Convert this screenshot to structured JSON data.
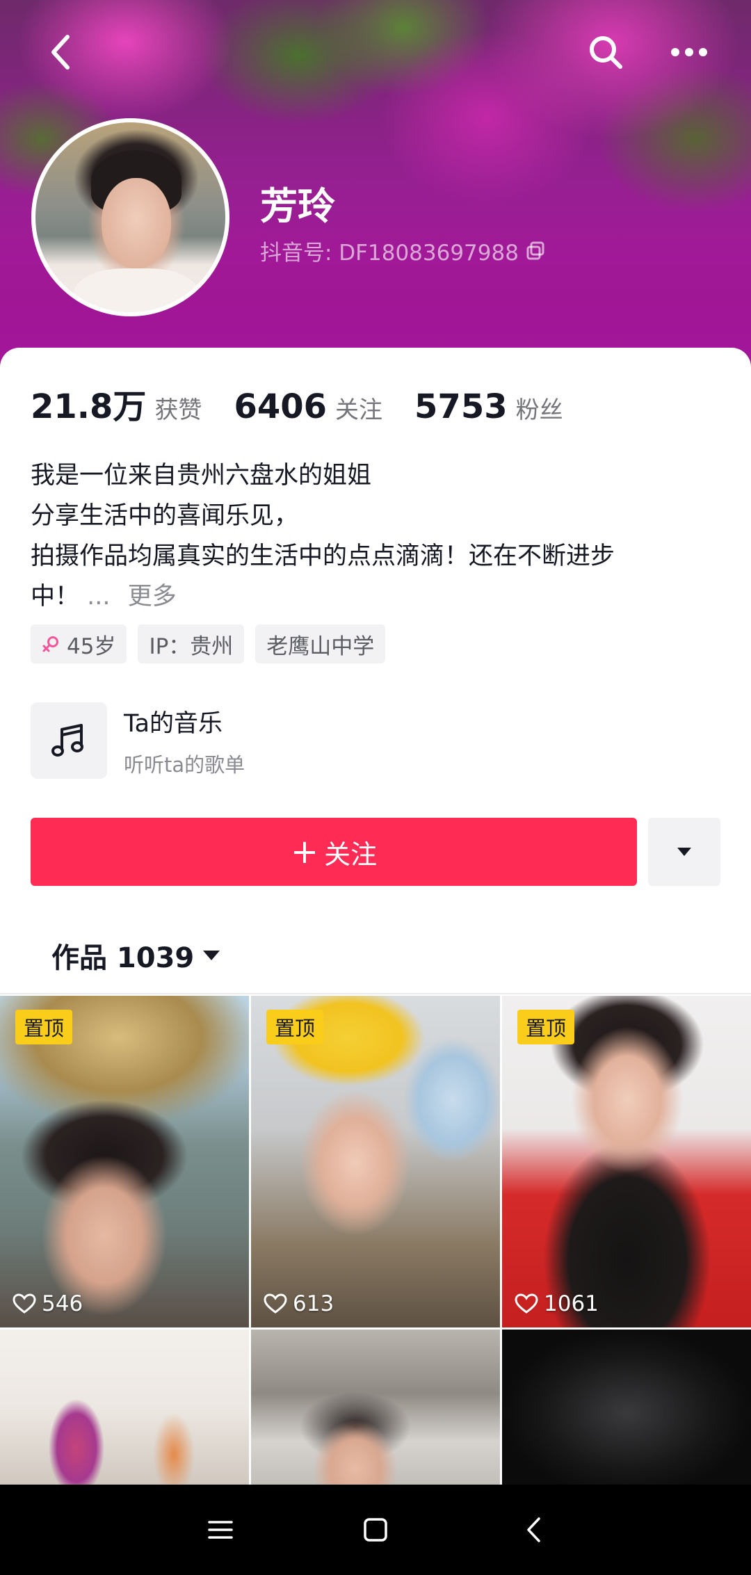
{
  "profile": {
    "name": "芳玲",
    "douyin_id": "抖音号: DF18083697988"
  },
  "stats": [
    {
      "value": "21.8万",
      "label": "获赞"
    },
    {
      "value": "6406",
      "label": "关注"
    },
    {
      "value": "5753",
      "label": "粉丝"
    }
  ],
  "bio": {
    "lines": [
      "我是一位来自贵州六盘水的姐姐",
      "分享生活中的喜闻乐见，",
      "拍摄作品均属真实的生活中的点点滴滴！还在不断进步",
      "中！"
    ],
    "ellipsis": "...",
    "more_label": "更多"
  },
  "tags": {
    "age": "45岁",
    "ip": "IP：贵州",
    "school": "老鹰山中学"
  },
  "music": {
    "title": "Ta的音乐",
    "subtitle": "听听ta的歌单"
  },
  "actions": {
    "follow_label": "关注",
    "follow_plus": "+"
  },
  "works_tab": {
    "label": "作品 1039"
  },
  "videos": [
    {
      "pinned_label": "置顶",
      "likes": "546"
    },
    {
      "pinned_label": "置顶",
      "likes": "613"
    },
    {
      "pinned_label": "置顶",
      "likes": "1061"
    },
    {
      "pinned_label": "",
      "likes": ""
    },
    {
      "pinned_label": "",
      "likes": ""
    },
    {
      "pinned_label": "",
      "likes": ""
    }
  ],
  "colors": {
    "accent": "#fe2c55",
    "pin_badge": "#facd1a",
    "banner": "#a3169b"
  },
  "icons": {
    "back": "chevron-left-icon",
    "search": "search-icon",
    "more": "more-dots-icon",
    "copy": "copy-icon",
    "gender": "female-icon",
    "music": "music-note-icon",
    "dropdown": "caret-down-icon",
    "like": "heart-icon"
  }
}
